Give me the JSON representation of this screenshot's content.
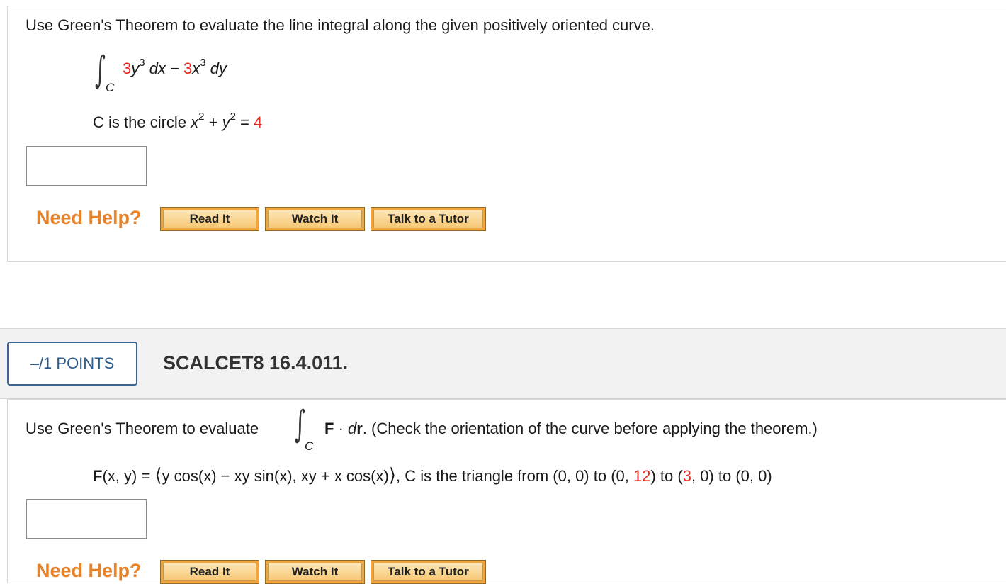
{
  "q1": {
    "prompt": "Use Green's Theorem to evaluate the line integral along the given positively oriented curve.",
    "integral_sub": "C",
    "term1_coef": "3",
    "term1_var": "y",
    "term1_exp": "3",
    "term1_dx": " dx",
    "minus": " − ",
    "term2_coef": "3",
    "term2_var": "x",
    "term2_exp": "3",
    "term2_dy": " dy",
    "circle_prefix": "C is the circle ",
    "circle_x": "x",
    "circle_x_exp": "2",
    "circle_plus": " + ",
    "circle_y": "y",
    "circle_y_exp": "2",
    "circle_eq": " = ",
    "circle_r2": "4",
    "answer_value": "",
    "need_help": "Need Help?",
    "buttons": [
      "Read It",
      "Watch It",
      "Talk to a Tutor"
    ]
  },
  "q2": {
    "points": "–/1 POINTS",
    "problem_id": "SCALCET8 16.4.011.",
    "prompt_before": "Use Green's Theorem to evaluate",
    "integral_sub": "C",
    "F_bold": "F",
    "dot": " · ",
    "dr_d": "d",
    "dr_r": "r",
    "prompt_after": ".   (Check the orientation of the curve before applying the theorem.)",
    "field_F": "F",
    "field_args": "(x, y) = ",
    "lang": "⟨",
    "field_body": "y cos(x) − xy sin(x), xy + x cos(x)",
    "rang": "⟩",
    "triangle_prefix": ", C is the triangle from (0, 0) to (0, ",
    "tri_y": "12",
    "triangle_mid": ") to (",
    "tri_x": "3",
    "triangle_end": ", 0) to (0, 0)",
    "answer_value": "",
    "need_help": "Need Help?",
    "buttons": [
      "Read It",
      "Watch It",
      "Talk to a Tutor"
    ]
  },
  "colors": {
    "accent_red": "#e8281e",
    "need_help_orange": "#e8832a",
    "badge_blue": "#2c5a89"
  }
}
